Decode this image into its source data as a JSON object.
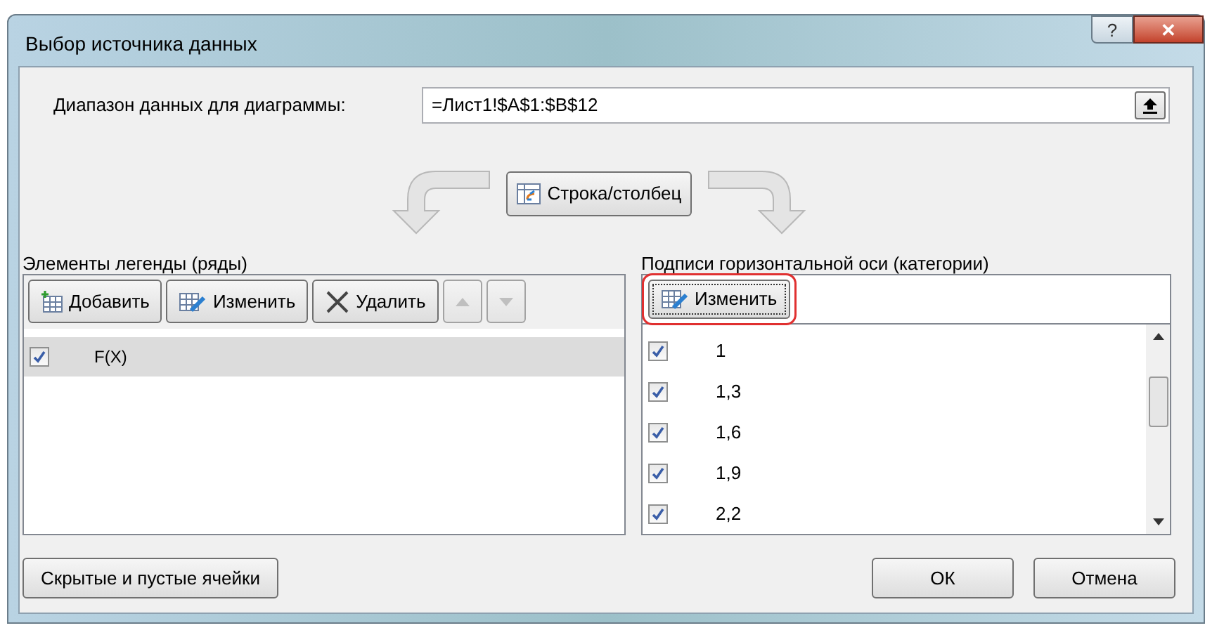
{
  "window": {
    "title": "Выбор источника данных",
    "controls": [
      {
        "kind": "help",
        "label": "?"
      },
      {
        "kind": "close",
        "label": "✕"
      }
    ]
  },
  "range": {
    "label": "Диапазон данных для диаграммы:",
    "value": "=Лист1!$A$1:$B$12"
  },
  "switch_button": {
    "label": "Строка/столбец"
  },
  "legend": {
    "title": "Элементы легенды (ряды)",
    "buttons": [
      {
        "kind": "add",
        "label": "Добавить",
        "disabled": false
      },
      {
        "kind": "edit",
        "label": "Изменить",
        "disabled": false
      },
      {
        "kind": "delete",
        "label": "Удалить",
        "disabled": false
      },
      {
        "kind": "up",
        "disabled": true
      },
      {
        "kind": "down",
        "disabled": true
      }
    ],
    "items": [
      {
        "label": "F(X)",
        "checked": true,
        "selected": true
      }
    ]
  },
  "axis": {
    "title": "Подписи горизонтальной оси (категории)",
    "edit_button": {
      "label": "Изменить",
      "highlighted": true
    },
    "items": [
      {
        "label": "1",
        "checked": true
      },
      {
        "label": "1,3",
        "checked": true
      },
      {
        "label": "1,6",
        "checked": true
      },
      {
        "label": "1,9",
        "checked": true
      },
      {
        "label": "2,2",
        "checked": true
      }
    ]
  },
  "footer": {
    "hidden_cells_button": "Скрытые и пустые ячейки",
    "ok": "ОК",
    "cancel": "Отмена"
  }
}
